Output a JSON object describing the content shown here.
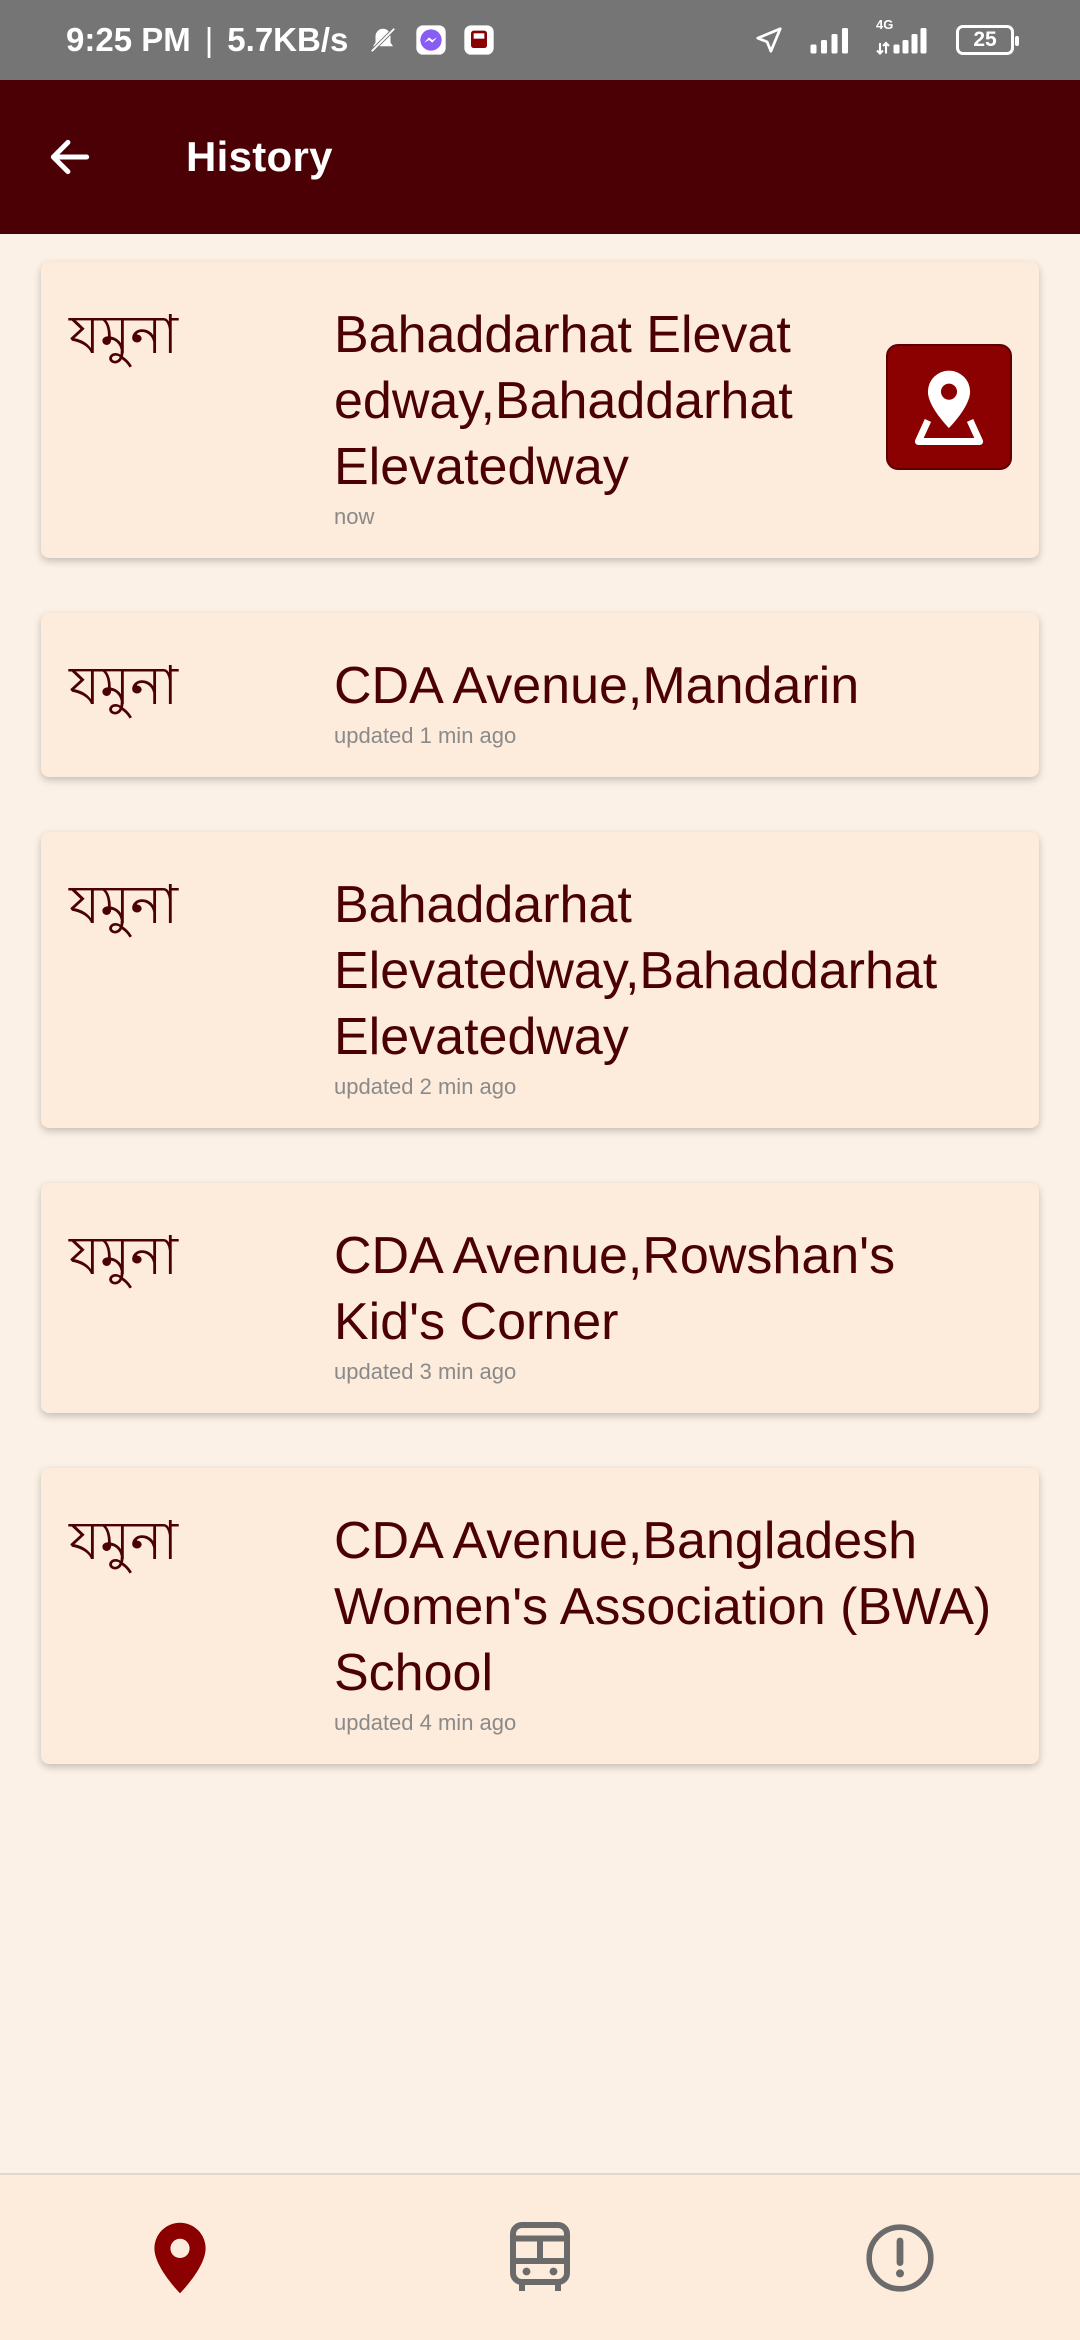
{
  "status_bar": {
    "time": "9:25 PM",
    "separator": "|",
    "speed": "5.7KB/s",
    "battery": "25",
    "network_label": "4G"
  },
  "app_bar": {
    "title": "History",
    "back_icon": "arrow-left-icon"
  },
  "history": [
    {
      "bus": "যমুনা",
      "location": "Bahaddarhat Elevat edway,Bahaddarhat Elevatedway",
      "time": "now"
    },
    {
      "bus": "যমুনা",
      "location": "CDA Avenue,Mandarin",
      "time": "updated 1 min ago"
    },
    {
      "bus": "যমুনা",
      "location": "Bahaddarhat Elevatedway,Bahaddarhat Elevatedway",
      "time": "updated 2 min ago"
    },
    {
      "bus": "যমুনা",
      "location": "CDA Avenue,Rowshan's Kid's Corner",
      "time": "updated 3 min ago"
    },
    {
      "bus": "যমুনা",
      "location": "CDA Avenue,Bangladesh Women's Association (BWA) School",
      "time": "updated 4 min ago"
    }
  ],
  "bottom_nav": [
    {
      "icon": "map-pin-icon",
      "active": true
    },
    {
      "icon": "bus-icon",
      "active": false
    },
    {
      "icon": "alert-circle-icon",
      "active": false
    }
  ],
  "colors": {
    "app_bar": "#4a0004",
    "accent": "#8b0000",
    "card": "#fdebdb",
    "background": "#fbf1e6",
    "status_bar": "#757575",
    "inactive_icon": "#6b6b6b"
  }
}
